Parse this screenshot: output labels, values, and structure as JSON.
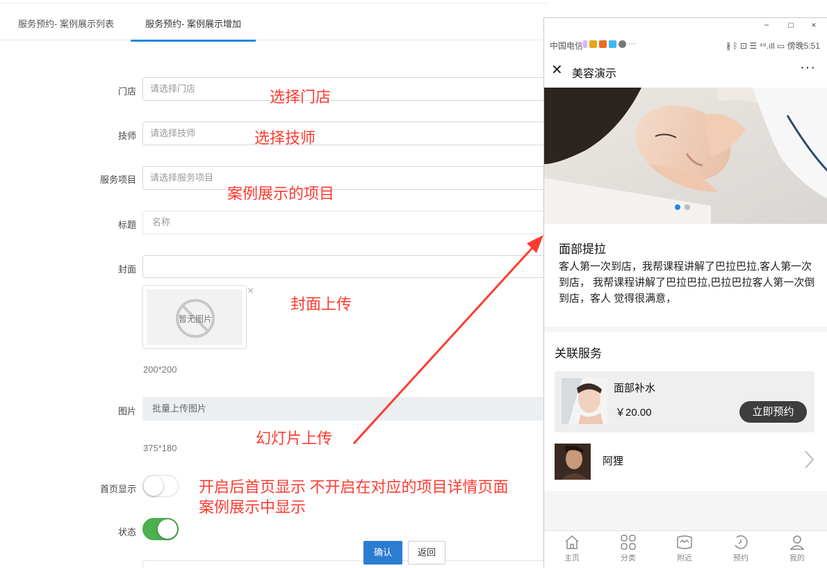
{
  "tabs": [
    {
      "label": "服务预约- 案例展示列表",
      "active": false
    },
    {
      "label": "服务预约- 案例展示增加",
      "active": true
    }
  ],
  "form": {
    "store": {
      "label": "门店",
      "placeholder": "请选择门店",
      "note": "选择门店"
    },
    "technician": {
      "label": "技师",
      "placeholder": "请选择技师",
      "note": "选择技师"
    },
    "service_item": {
      "label": "服务项目",
      "placeholder": "请选择服务项目",
      "note": "案例展示的项目"
    },
    "title": {
      "label": "标题",
      "placeholder": "名称"
    },
    "cover": {
      "label": "封面",
      "value": "",
      "no_image_text": "暂无图片",
      "close_glyph": "×",
      "size_hint": "200*200",
      "note": "封面上传"
    },
    "images": {
      "label": "图片",
      "button": "批量上传图片",
      "size_hint": "375*180",
      "note": "幻灯片上传"
    },
    "home_display": {
      "label": "首页显示",
      "enabled": false,
      "note_line1": "开启后首页显示  不开启在对应的项目详情页面",
      "note_line2": "案例展示中显示"
    },
    "status": {
      "label": "状态",
      "enabled": true
    },
    "confirm_button": "确认",
    "back_button": "返回"
  },
  "colors": {
    "accent": "#1e88e5",
    "note_red": "#ff3b30",
    "switch_on": "#4caf50",
    "confirm_bg": "#2b7dd2"
  },
  "phone": {
    "window_controls": {
      "minimize": "−",
      "maximize": "□",
      "close": "×"
    },
    "statusbar": {
      "carrier": "中国电信",
      "more": "···",
      "right": "∦ ᛒ ⊡ ☰ ⁴⁶.ıll ▭ 傍晚5:51"
    },
    "navbar": {
      "close": "✕",
      "title": "美容演示",
      "more": "···"
    },
    "banner": {
      "slides": 2,
      "active": 0
    },
    "case": {
      "title": "面部提拉",
      "description": "客人第一次到店，我帮课程讲解了巴拉巴拉,客人第一次到店， 我帮课程讲解了巴拉巴拉,巴拉巴拉客人第一次倒到店，客人 觉得很满意，"
    },
    "related": {
      "title": "关联服务",
      "services": [
        {
          "name": "面部补水",
          "price": "￥20.00",
          "button": "立即预约"
        },
        {
          "name": "阿狸"
        }
      ]
    },
    "tabbar": [
      {
        "label": "主页",
        "icon": "home-icon"
      },
      {
        "label": "分类",
        "icon": "grid-icon"
      },
      {
        "label": "附近",
        "icon": "map-icon"
      },
      {
        "label": "预约",
        "icon": "clock-icon"
      },
      {
        "label": "我的",
        "icon": "user-icon"
      }
    ]
  }
}
